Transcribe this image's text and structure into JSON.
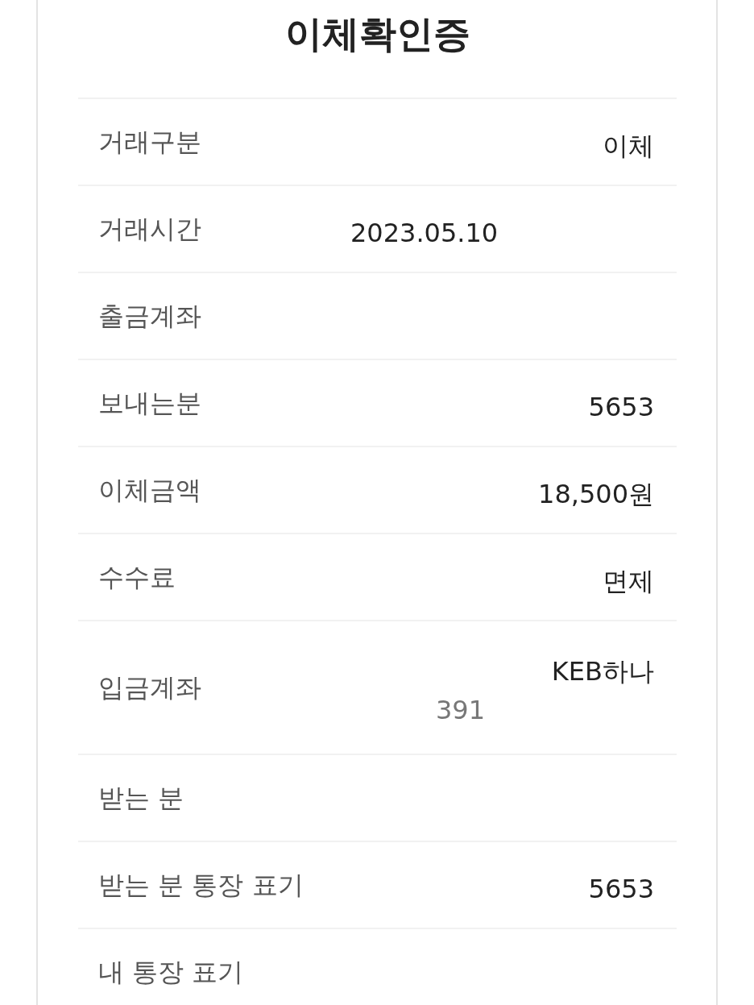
{
  "title": "이체확인증",
  "rows": [
    {
      "label": "거래구분",
      "values": [
        {
          "kind": "primary",
          "text": "이체"
        }
      ]
    },
    {
      "label": "거래시간",
      "values": [
        {
          "kind": "date",
          "text": "2023.05.10"
        }
      ]
    },
    {
      "label": "출금계좌"
    },
    {
      "label": "보내는분",
      "values": [
        {
          "kind": "primary",
          "text": "5653"
        }
      ]
    },
    {
      "label": "이체금액",
      "values": [
        {
          "kind": "primary",
          "text": "18,500원"
        }
      ]
    },
    {
      "label": "수수료",
      "values": [
        {
          "kind": "primary",
          "text": "면제"
        }
      ]
    },
    {
      "label": "입금계좌",
      "values": [
        {
          "kind": "primary",
          "text": "KEB하나"
        },
        {
          "kind": "secondary",
          "text": "391"
        }
      ]
    },
    {
      "label": "받는 분"
    },
    {
      "label": "받는 분 통장 표기",
      "values": [
        {
          "kind": "primary",
          "text": "5653"
        }
      ]
    },
    {
      "label": "내 통장 표기"
    }
  ]
}
